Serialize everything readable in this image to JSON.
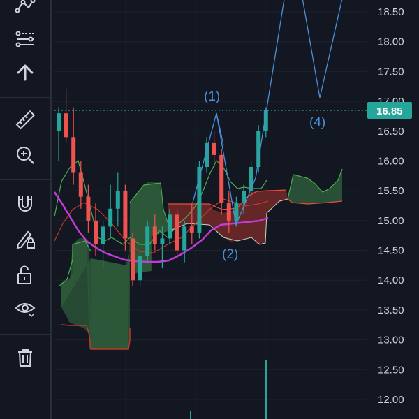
{
  "toolbar": {
    "items": [
      {
        "name": "pattern-tool-icon"
      },
      {
        "name": "indicator-tool-icon"
      },
      {
        "name": "arrow-up-icon"
      },
      {
        "name": "ruler-icon"
      },
      {
        "name": "zoom-in-icon"
      },
      {
        "name": "magnet-icon"
      },
      {
        "name": "lock-drawing-icon"
      },
      {
        "name": "unlock-icon"
      },
      {
        "name": "eye-icon"
      },
      {
        "name": "trash-icon"
      }
    ]
  },
  "price_axis": {
    "labels": [
      "18.50",
      "18.00",
      "17.50",
      "17.00",
      "16.50",
      "16.00",
      "15.50",
      "15.00",
      "14.50",
      "14.00",
      "13.50",
      "13.00",
      "12.50",
      "12.00"
    ],
    "current_price": "16.85",
    "current_color": "#26a69a"
  },
  "chart_data": {
    "type": "candlestick",
    "y_range": [
      11.75,
      18.65
    ],
    "elliott_labels": [
      {
        "label": "(1)",
        "x_index": 21,
        "price": 17.05
      },
      {
        "label": "(2)",
        "x_index": 23,
        "price": 14.55
      },
      {
        "label": "(4)",
        "x_index": 35,
        "price": 16.7
      }
    ],
    "candles": [
      {
        "o": 16.5,
        "h": 16.9,
        "l": 16.0,
        "c": 16.8
      },
      {
        "o": 16.8,
        "h": 17.2,
        "l": 16.3,
        "c": 16.4
      },
      {
        "o": 16.4,
        "h": 16.9,
        "l": 15.6,
        "c": 15.8
      },
      {
        "o": 15.8,
        "h": 16.0,
        "l": 15.2,
        "c": 15.4
      },
      {
        "o": 15.4,
        "h": 15.6,
        "l": 14.8,
        "c": 15.0
      },
      {
        "o": 15.0,
        "h": 15.3,
        "l": 14.4,
        "c": 14.6
      },
      {
        "o": 14.6,
        "h": 15.0,
        "l": 14.2,
        "c": 14.9
      },
      {
        "o": 14.9,
        "h": 15.6,
        "l": 14.7,
        "c": 15.2
      },
      {
        "o": 15.2,
        "h": 15.8,
        "l": 14.9,
        "c": 15.5
      },
      {
        "o": 15.5,
        "h": 15.6,
        "l": 14.5,
        "c": 14.7
      },
      {
        "o": 14.7,
        "h": 14.8,
        "l": 13.9,
        "c": 14.0
      },
      {
        "o": 14.0,
        "h": 14.5,
        "l": 13.9,
        "c": 14.4
      },
      {
        "o": 14.4,
        "h": 15.0,
        "l": 14.3,
        "c": 14.9
      },
      {
        "o": 14.9,
        "h": 15.1,
        "l": 14.5,
        "c": 14.6
      },
      {
        "o": 14.6,
        "h": 14.9,
        "l": 14.2,
        "c": 14.7
      },
      {
        "o": 14.7,
        "h": 15.2,
        "l": 14.6,
        "c": 15.1
      },
      {
        "o": 15.1,
        "h": 15.2,
        "l": 14.4,
        "c": 14.5
      },
      {
        "o": 14.5,
        "h": 15.0,
        "l": 14.3,
        "c": 14.9
      },
      {
        "o": 14.9,
        "h": 15.3,
        "l": 14.6,
        "c": 14.8
      },
      {
        "o": 14.8,
        "h": 16.0,
        "l": 14.7,
        "c": 15.9
      },
      {
        "o": 15.9,
        "h": 16.4,
        "l": 15.8,
        "c": 16.3
      },
      {
        "o": 16.3,
        "h": 16.5,
        "l": 15.9,
        "c": 16.1
      },
      {
        "o": 16.1,
        "h": 16.2,
        "l": 15.1,
        "c": 15.3
      },
      {
        "o": 15.3,
        "h": 15.5,
        "l": 14.8,
        "c": 15.0
      },
      {
        "o": 15.0,
        "h": 15.4,
        "l": 14.9,
        "c": 15.3
      },
      {
        "o": 15.3,
        "h": 15.6,
        "l": 15.1,
        "c": 15.5
      },
      {
        "o": 15.5,
        "h": 16.0,
        "l": 15.4,
        "c": 15.9
      },
      {
        "o": 15.9,
        "h": 16.6,
        "l": 15.8,
        "c": 16.5
      },
      {
        "o": 16.5,
        "h": 16.9,
        "l": 16.4,
        "c": 16.85
      }
    ]
  }
}
